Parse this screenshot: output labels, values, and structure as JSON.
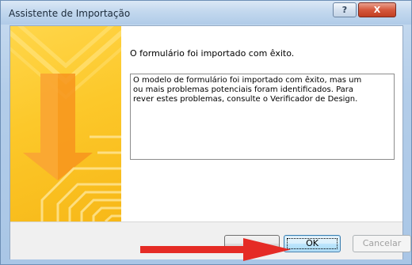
{
  "window": {
    "title": "Assistente de Importação",
    "help_label": "?",
    "close_label": "X"
  },
  "main": {
    "heading": "O formulário foi importado com êxito.",
    "details": "O modelo de formulário foi importado com êxito, mas um\nou mais problemas potenciais foram identificados. Para\nrever estes problemas, consulte o Verificador de Design."
  },
  "buttons": {
    "blank_label": "",
    "ok_label": "OK",
    "cancel_label": "Cancelar"
  },
  "annotation": {
    "arrow_color": "#e52b25"
  },
  "colors": {
    "banner_yellow": "#fcc82a",
    "banner_orange": "#f7941d"
  }
}
